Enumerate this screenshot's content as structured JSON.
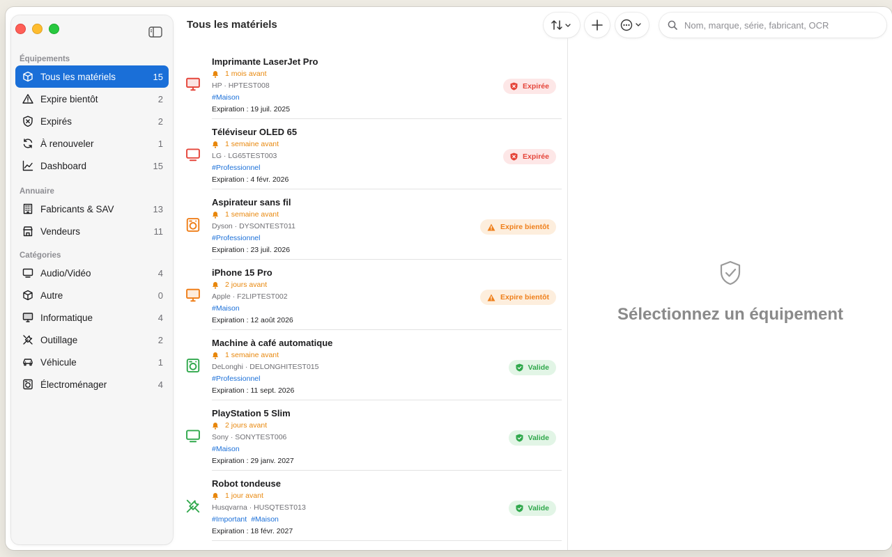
{
  "sidebar": {
    "sections": [
      {
        "header": "Équipements",
        "items": [
          {
            "label": "Tous les matériels",
            "count": "15",
            "icon": "cube-icon",
            "active": true
          },
          {
            "label": "Expire bientôt",
            "count": "2",
            "icon": "warning-triangle-icon"
          },
          {
            "label": "Expirés",
            "count": "2",
            "icon": "shield-x-icon"
          },
          {
            "label": "À renouveler",
            "count": "1",
            "icon": "renew-arrows-icon"
          },
          {
            "label": "Dashboard",
            "count": "15",
            "icon": "chart-line-icon"
          }
        ]
      },
      {
        "header": "Annuaire",
        "items": [
          {
            "label": "Fabricants & SAV",
            "count": "13",
            "icon": "building-icon"
          },
          {
            "label": "Vendeurs",
            "count": "11",
            "icon": "storefront-icon"
          }
        ]
      },
      {
        "header": "Catégories",
        "items": [
          {
            "label": "Audio/Vidéo",
            "count": "4",
            "icon": "tv-icon"
          },
          {
            "label": "Autre",
            "count": "0",
            "icon": "cube-icon"
          },
          {
            "label": "Informatique",
            "count": "4",
            "icon": "desktop-icon"
          },
          {
            "label": "Outillage",
            "count": "2",
            "icon": "tools-icon"
          },
          {
            "label": "Véhicule",
            "count": "1",
            "icon": "car-icon"
          },
          {
            "label": "Électroménager",
            "count": "4",
            "icon": "washer-icon"
          }
        ]
      }
    ]
  },
  "list": {
    "title": "Tous les matériels",
    "items": [
      {
        "name": "Imprimante LaserJet Pro",
        "reminder": "1 mois avant",
        "brand_serial": "HP · HPTEST008",
        "tags": [
          "#Maison"
        ],
        "expiration": "Expiration : 19 juil. 2025",
        "status": "Expirée",
        "status_type": "expired",
        "icon": "desktop-icon",
        "icon_color": "#e5453a"
      },
      {
        "name": "Téléviseur OLED 65",
        "reminder": "1 semaine avant",
        "brand_serial": "LG · LG65TEST003",
        "tags": [
          "#Professionnel"
        ],
        "expiration": "Expiration : 4 févr. 2026",
        "status": "Expirée",
        "status_type": "expired",
        "icon": "tv-icon",
        "icon_color": "#e5453a"
      },
      {
        "name": "Aspirateur sans fil",
        "reminder": "1 semaine avant",
        "brand_serial": "Dyson · DYSONTEST011",
        "tags": [
          "#Professionnel"
        ],
        "expiration": "Expiration : 23 juil. 2026",
        "status": "Expire bientôt",
        "status_type": "soon",
        "icon": "washer-icon",
        "icon_color": "#ef7f1a"
      },
      {
        "name": "iPhone 15 Pro",
        "reminder": "2 jours avant",
        "brand_serial": "Apple · F2LIPTEST002",
        "tags": [
          "#Maison"
        ],
        "expiration": "Expiration : 12 août 2026",
        "status": "Expire bientôt",
        "status_type": "soon",
        "icon": "desktop-icon",
        "icon_color": "#ef7f1a"
      },
      {
        "name": "Machine à café automatique",
        "reminder": "1 semaine avant",
        "brand_serial": "DeLonghi · DELONGHITEST015",
        "tags": [
          "#Professionnel"
        ],
        "expiration": "Expiration : 11 sept. 2026",
        "status": "Valide",
        "status_type": "valid",
        "icon": "washer-icon",
        "icon_color": "#30a84c"
      },
      {
        "name": "PlayStation 5 Slim",
        "reminder": "2 jours avant",
        "brand_serial": "Sony · SONYTEST006",
        "tags": [
          "#Maison"
        ],
        "expiration": "Expiration : 29 janv. 2027",
        "status": "Valide",
        "status_type": "valid",
        "icon": "tv-icon",
        "icon_color": "#30a84c"
      },
      {
        "name": "Robot tondeuse",
        "reminder": "1 jour avant",
        "brand_serial": "Husqvarna · HUSQTEST013",
        "tags": [
          "#Important",
          "#Maison"
        ],
        "expiration": "Expiration : 18 févr. 2027",
        "status": "Valide",
        "status_type": "valid",
        "icon": "tools-icon",
        "icon_color": "#30a84c"
      }
    ]
  },
  "toolbar": {
    "sort_icon": "sort-arrows-icon",
    "add_icon": "plus-icon",
    "more_icon": "ellipsis-circle-icon",
    "search_placeholder": "Nom, marque, série, fabricant, OCR"
  },
  "detail": {
    "empty_message": "Sélectionnez un équipement",
    "icon": "shield-check-icon"
  },
  "colors": {
    "accent": "#1a6fd8",
    "expired": "#e5453a",
    "soon": "#ef7f1a",
    "valid": "#30a84c",
    "reminder": "#e8870c"
  }
}
